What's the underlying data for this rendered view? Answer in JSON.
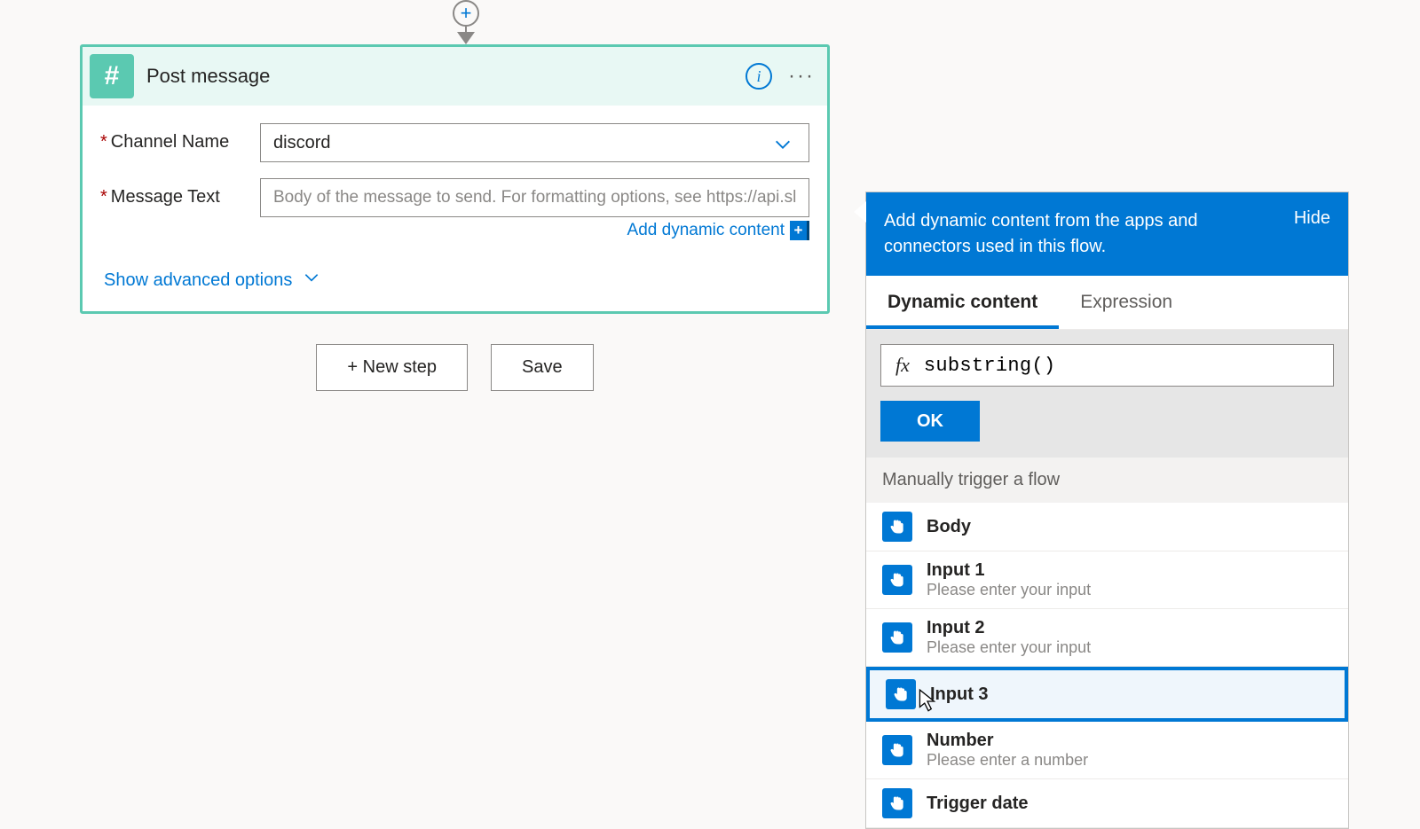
{
  "connector": {
    "plus": "+"
  },
  "card": {
    "title": "Post message",
    "icon_glyph": "#",
    "fields": {
      "channel": {
        "label": "Channel Name",
        "value": "discord"
      },
      "message": {
        "label": "Message Text",
        "placeholder": "Body of the message to send. For formatting options, see https://api.slack.com."
      }
    },
    "add_dynamic": "Add dynamic content",
    "advanced": "Show advanced options"
  },
  "buttons": {
    "new_step": "+ New step",
    "save": "Save"
  },
  "panel": {
    "header": "Add dynamic content from the apps and connectors used in this flow.",
    "hide": "Hide",
    "tabs": {
      "dynamic": "Dynamic content",
      "expression": "Expression"
    },
    "fx": {
      "label": "fx",
      "value": "substring()"
    },
    "ok": "OK",
    "group": "Manually trigger a flow",
    "items": [
      {
        "title": "Body",
        "desc": ""
      },
      {
        "title": "Input 1",
        "desc": "Please enter your input"
      },
      {
        "title": "Input 2",
        "desc": "Please enter your input"
      },
      {
        "title": "Input 3",
        "desc": "",
        "highlight": true
      },
      {
        "title": "Number",
        "desc": "Please enter a number"
      },
      {
        "title": "Trigger date",
        "desc": ""
      }
    ]
  }
}
